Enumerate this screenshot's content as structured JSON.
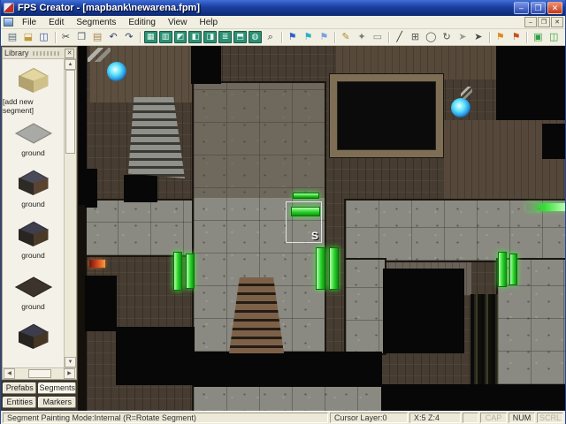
{
  "window": {
    "title": "FPS Creator - [mapbank\\newarena.fpm]"
  },
  "titlebar_controls": {
    "minimize": "–",
    "restore": "❐",
    "close": "✕"
  },
  "menubar": {
    "items": [
      "File",
      "Edit",
      "Segments",
      "Editing",
      "View",
      "Help"
    ],
    "mdi": {
      "minimize": "–",
      "restore": "❐",
      "close": "✕"
    }
  },
  "toolbar": {
    "groups": [
      [
        {
          "name": "new-button",
          "glyph": "▤",
          "fg": "#5a6a7a"
        },
        {
          "name": "open-button",
          "glyph": "⬓",
          "fg": "#c29a38"
        },
        {
          "name": "save-button",
          "glyph": "◫",
          "fg": "#3456aa"
        }
      ],
      [
        {
          "name": "cut-button",
          "glyph": "✂",
          "fg": "#444444"
        },
        {
          "name": "copy-button",
          "glyph": "❐",
          "fg": "#556070"
        },
        {
          "name": "paste-button",
          "glyph": "▤",
          "fg": "#a8894f"
        },
        {
          "name": "undo-button",
          "glyph": "↶",
          "fg": "#334466"
        },
        {
          "name": "redo-button",
          "glyph": "↷",
          "fg": "#334466"
        }
      ],
      [
        {
          "name": "segment-floor-button",
          "glyph": "▦",
          "fg": "#eafff4",
          "bg": "#2d8f74"
        },
        {
          "name": "segment-wall-button",
          "glyph": "▥",
          "fg": "#eafff4",
          "bg": "#2d8f74"
        },
        {
          "name": "segment-room-button",
          "glyph": "◩",
          "fg": "#eafff4",
          "bg": "#2d8f74"
        },
        {
          "name": "segment-door-button",
          "glyph": "◧",
          "fg": "#eafff4",
          "bg": "#2d8f74"
        },
        {
          "name": "segment-window-button",
          "glyph": "◨",
          "fg": "#eafff4",
          "bg": "#2d8f74"
        },
        {
          "name": "segment-stairs-button",
          "glyph": "≣",
          "fg": "#eafff4",
          "bg": "#2d8f74"
        },
        {
          "name": "segment-platform-button",
          "glyph": "⬒",
          "fg": "#eafff4",
          "bg": "#2d8f74"
        },
        {
          "name": "segment-light-button",
          "glyph": "◍",
          "fg": "#eafff4",
          "bg": "#2d8f74"
        },
        {
          "name": "zoom-button",
          "glyph": "⌕",
          "fg": "#333333"
        }
      ],
      [
        {
          "name": "flag-blue-button",
          "glyph": "⚑",
          "fg": "#2f5fd0"
        },
        {
          "name": "flag-cyan-button",
          "glyph": "⚑",
          "fg": "#28b0c8"
        },
        {
          "name": "flag-add-button",
          "glyph": "⚑",
          "fg": "#7aa0e0"
        }
      ],
      [
        {
          "name": "brush-button",
          "glyph": "✎",
          "fg": "#b08830"
        },
        {
          "name": "wand-button",
          "glyph": "✦",
          "fg": "#7a7a7a"
        },
        {
          "name": "eraser-button",
          "glyph": "▭",
          "fg": "#888888"
        }
      ],
      [
        {
          "name": "line-button",
          "glyph": "╱",
          "fg": "#333333"
        },
        {
          "name": "grid-button",
          "glyph": "⊞",
          "fg": "#555555"
        },
        {
          "name": "circle-button",
          "glyph": "◯",
          "fg": "#555555"
        },
        {
          "name": "rotate-button",
          "glyph": "↻",
          "fg": "#555555"
        },
        {
          "name": "pointer-light-button",
          "glyph": "➤",
          "fg": "#9a9a9a"
        },
        {
          "name": "pointer-dark-button",
          "glyph": "➤",
          "fg": "#4a4a4a"
        }
      ],
      [
        {
          "name": "marker-flag-orange-button",
          "glyph": "⚑",
          "fg": "#e08820"
        },
        {
          "name": "marker-flag-red-button",
          "glyph": "⚑",
          "fg": "#c85020"
        }
      ],
      [
        {
          "name": "test-game-button",
          "glyph": "▣",
          "fg": "#2fa040"
        },
        {
          "name": "build-game-button",
          "glyph": "◫",
          "fg": "#2fa040"
        }
      ]
    ]
  },
  "library": {
    "title": "Library",
    "items": [
      {
        "label": "[add new segment]",
        "icon": "add-segment-block"
      },
      {
        "label": "ground",
        "icon": "tile-flat-gray flat"
      },
      {
        "label": "ground",
        "icon": "cube-dark"
      },
      {
        "label": "ground",
        "icon": "cube-dark2"
      },
      {
        "label": "ground",
        "icon": "tile-flat-dark flat"
      },
      {
        "label": "",
        "icon": "cube-partial"
      }
    ],
    "tabs": [
      {
        "label": "Prefabs",
        "active": false
      },
      {
        "label": "Segments",
        "active": true
      },
      {
        "label": "Entities",
        "active": false
      },
      {
        "label": "Markers",
        "active": false
      }
    ]
  },
  "canvas": {
    "cursor_label": "S"
  },
  "statusbar": {
    "mode": "Segment Painting Mode:Internal (R=Rotate Segment)",
    "cursor_layer": "Cursor Layer:0",
    "coords": "X:5  Z:4",
    "indicators": [
      {
        "label": "CAP",
        "active": false
      },
      {
        "label": "NUM",
        "active": true
      },
      {
        "label": "SCRL",
        "active": false
      }
    ]
  },
  "colors": {
    "accent_green": "#28d428",
    "orb_blue": "#5ae0f8",
    "wall_brown": "#463c31",
    "floor_gray": "#8b8a82",
    "title_blue": "#1b3f9e"
  }
}
